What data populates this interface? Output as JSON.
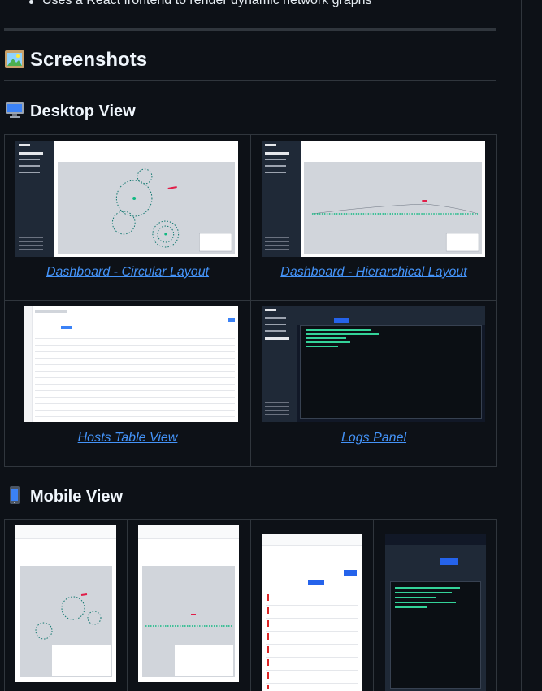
{
  "intro": {
    "bullet": "Uses a React frontend to render dynamic network graphs"
  },
  "screenshots": {
    "heading": "Screenshots",
    "heading_icon": "framed-picture-icon"
  },
  "desktop": {
    "heading": "Desktop View",
    "heading_icon": "desktop-computer-icon",
    "items": [
      {
        "caption": "Dashboard - Circular Layout"
      },
      {
        "caption": "Dashboard - Hierarchical Layout"
      },
      {
        "caption": "Hosts Table View"
      },
      {
        "caption": "Logs Panel"
      }
    ]
  },
  "mobile": {
    "heading": "Mobile View",
    "heading_icon": "mobile-phone-icon"
  },
  "colors": {
    "link": "#4493f8",
    "background": "#0d1117",
    "border": "#30363d"
  }
}
